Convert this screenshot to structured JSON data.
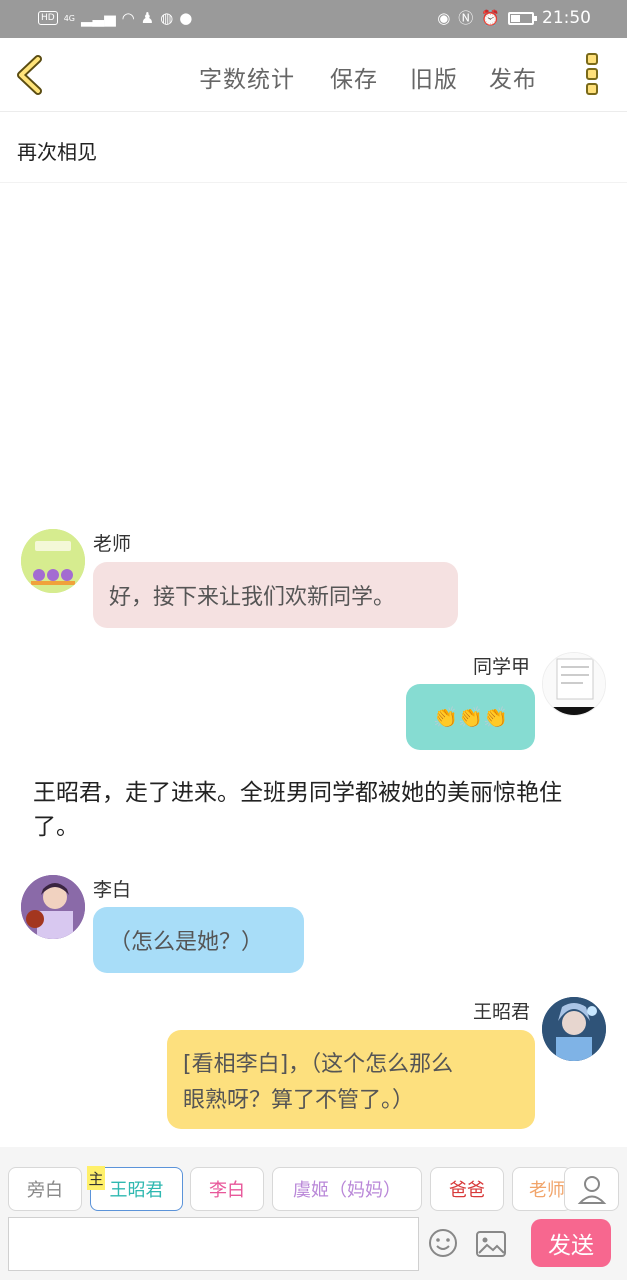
{
  "status_bar": {
    "network_label": "HD",
    "generation": "4G",
    "time": "21:50"
  },
  "header": {
    "back_icon": "chevron-left-icon",
    "word_count": "字数统计",
    "save": "保存",
    "old_version": "旧版",
    "publish": "发布",
    "more_icon": "more-vertical-icon"
  },
  "story": {
    "title": "再次相见"
  },
  "messages": [
    {
      "speaker": "老师",
      "text": "好，接下来让我们欢新同学。",
      "side": "left",
      "bubble_color": "#f5e1e1"
    },
    {
      "speaker": "同学甲",
      "text": "👏👏👏",
      "side": "right",
      "bubble_color": "#86dcd2"
    },
    {
      "narration": "王昭君，走了进来。全班男同学都被她的美丽惊艳住了。"
    },
    {
      "speaker": "李白",
      "text": "（怎么是她？）",
      "side": "left",
      "bubble_color": "#a8ddf8"
    },
    {
      "speaker": "王昭君",
      "lines": [
        "[看相李白]，（这个怎么那么",
        "眼熟呀？算了不管了。）"
      ],
      "side": "right",
      "bubble_color": "#fde07e"
    }
  ],
  "characters": [
    {
      "label": "旁白",
      "color": "#888888"
    },
    {
      "label": "王昭君",
      "color": "#2fb8b0",
      "selected": true,
      "badge": "主"
    },
    {
      "label": "李白",
      "color": "#e8579a"
    },
    {
      "label": "虞姬（妈妈）",
      "color": "#b987d8"
    },
    {
      "label": "爸爸",
      "color": "#d83a3a"
    },
    {
      "label": "老师",
      "color": "#f1a46a"
    }
  ],
  "composer": {
    "input_value": "",
    "emoji_icon": "smiley-icon",
    "image_icon": "image-icon",
    "send": "发送",
    "user_icon": "user-icon"
  }
}
